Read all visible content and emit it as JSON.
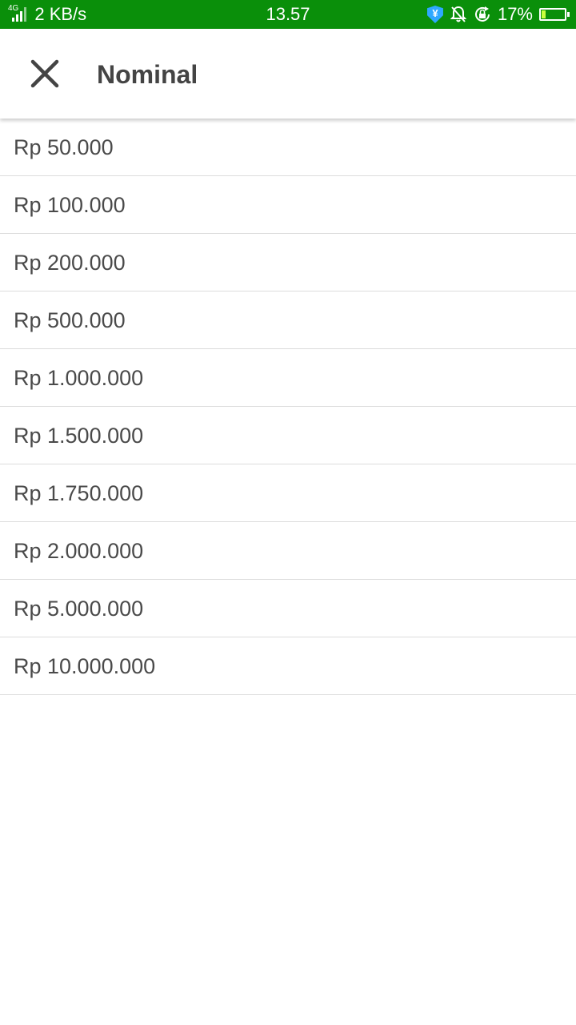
{
  "status_bar": {
    "network_type": "4G",
    "speed": "2 KB/s",
    "time": "13.57",
    "battery_percent": "17%",
    "battery_level": 0.17,
    "background_color": "#0a8f0a",
    "icons": [
      "signal-icon",
      "shield-icon",
      "bell-off-icon",
      "lock-rotate-icon",
      "battery-charging-icon"
    ]
  },
  "header": {
    "close_icon": "close-icon",
    "title": "Nominal"
  },
  "nominal_options": [
    "Rp 50.000",
    "Rp 100.000",
    "Rp 200.000",
    "Rp 500.000",
    "Rp 1.000.000",
    "Rp 1.500.000",
    "Rp 1.750.000",
    "Rp 2.000.000",
    "Rp 5.000.000",
    "Rp 10.000.000"
  ]
}
